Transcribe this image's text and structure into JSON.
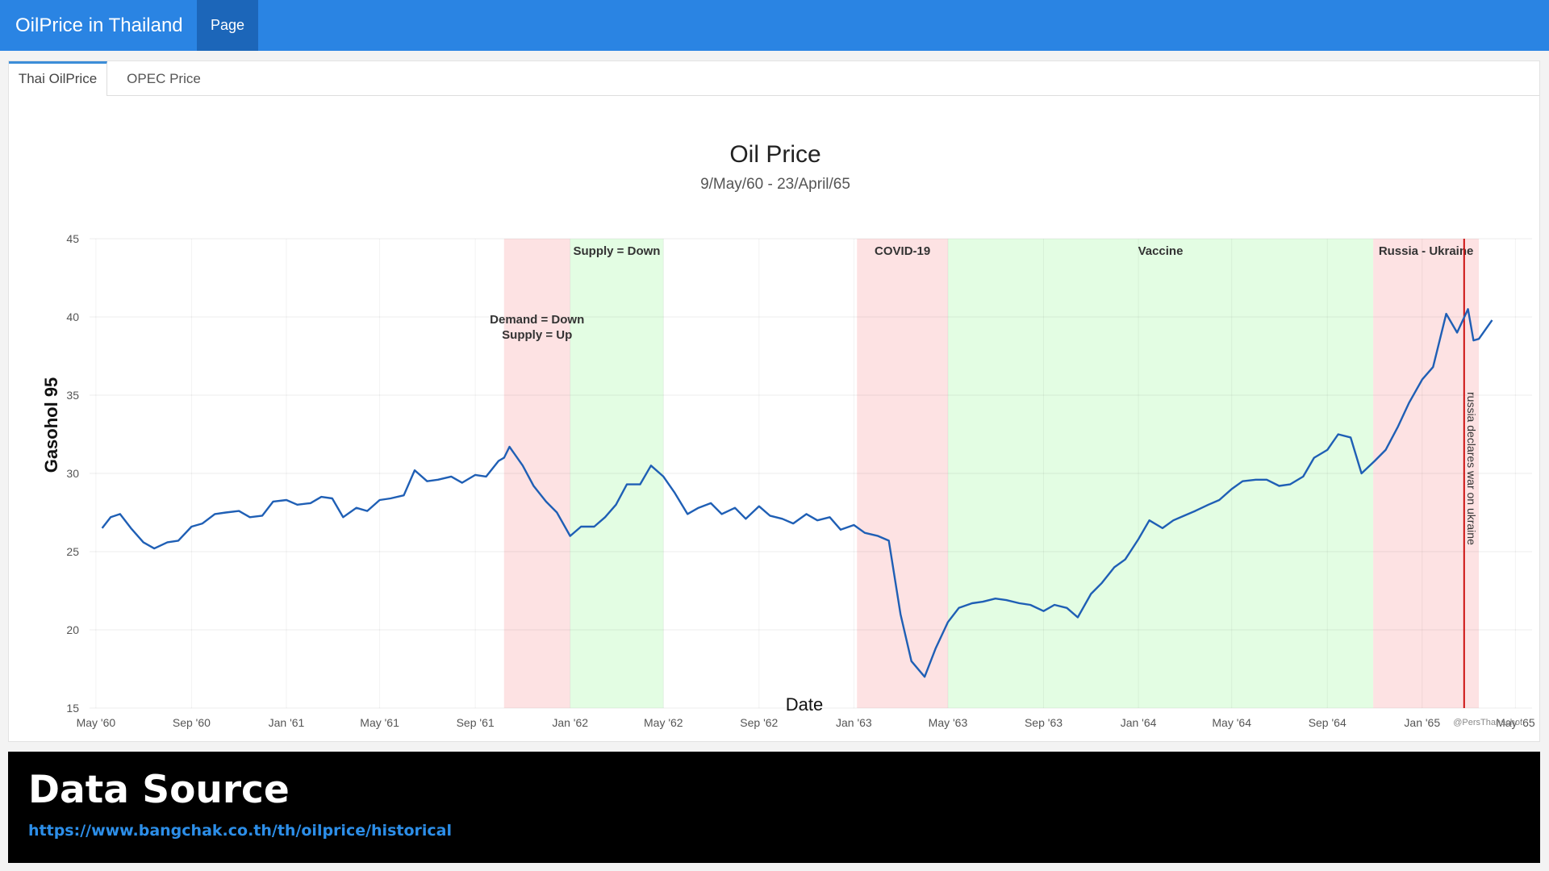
{
  "navbar": {
    "brand": "OilPrice in Thailand",
    "items": [
      {
        "label": "Page"
      }
    ]
  },
  "tabs": [
    {
      "label": "Thai OilPrice",
      "active": true
    },
    {
      "label": "OPEC Price",
      "active": false
    }
  ],
  "chart_data": {
    "type": "line",
    "title": "Oil Price",
    "subtitle": "9/May/60 - 23/April/65",
    "xlabel": "Date",
    "ylabel": "Gasohol 95",
    "ylim": [
      15,
      45
    ],
    "y_ticks": [
      15,
      20,
      25,
      30,
      35,
      40,
      45
    ],
    "x_ticks": [
      "May '60",
      "Sep '60",
      "Jan '61",
      "May '61",
      "Sep '61",
      "Jan '62",
      "May '62",
      "Sep '62",
      "Jan '63",
      "May '63",
      "Sep '63",
      "Jan '64",
      "May '64",
      "Sep '64",
      "Jan '65",
      "May '65"
    ],
    "grid": true,
    "line_color": "#1f5fb5",
    "x": [
      "2017-05-09",
      "2017-05-20",
      "2017-06-01",
      "2017-06-15",
      "2017-07-01",
      "2017-07-15",
      "2017-08-01",
      "2017-08-15",
      "2017-09-01",
      "2017-09-15",
      "2017-10-01",
      "2017-10-15",
      "2017-11-01",
      "2017-11-15",
      "2017-12-01",
      "2017-12-15",
      "2018-01-01",
      "2018-01-15",
      "2018-02-01",
      "2018-02-15",
      "2018-03-01",
      "2018-03-15",
      "2018-04-01",
      "2018-04-15",
      "2018-05-01",
      "2018-05-15",
      "2018-06-01",
      "2018-06-15",
      "2018-07-01",
      "2018-07-15",
      "2018-08-01",
      "2018-08-15",
      "2018-09-01",
      "2018-09-15",
      "2018-10-01",
      "2018-10-08",
      "2018-10-15",
      "2018-11-01",
      "2018-11-15",
      "2018-12-01",
      "2018-12-15",
      "2019-01-01",
      "2019-01-15",
      "2019-02-01",
      "2019-02-15",
      "2019-03-01",
      "2019-03-15",
      "2019-04-01",
      "2019-04-15",
      "2019-05-01",
      "2019-05-15",
      "2019-06-01",
      "2019-06-15",
      "2019-07-01",
      "2019-07-15",
      "2019-08-01",
      "2019-08-15",
      "2019-09-01",
      "2019-09-15",
      "2019-10-01",
      "2019-10-15",
      "2019-11-01",
      "2019-11-15",
      "2019-12-01",
      "2019-12-15",
      "2020-01-01",
      "2020-01-15",
      "2020-02-01",
      "2020-02-15",
      "2020-03-01",
      "2020-03-15",
      "2020-04-01",
      "2020-04-15",
      "2020-05-01",
      "2020-05-15",
      "2020-06-01",
      "2020-06-15",
      "2020-07-01",
      "2020-07-15",
      "2020-08-01",
      "2020-08-15",
      "2020-09-01",
      "2020-09-15",
      "2020-10-01",
      "2020-10-15",
      "2020-11-01",
      "2020-11-15",
      "2020-12-01",
      "2020-12-15",
      "2021-01-01",
      "2021-01-15",
      "2021-02-01",
      "2021-02-15",
      "2021-03-01",
      "2021-03-15",
      "2021-04-01",
      "2021-04-15",
      "2021-05-01",
      "2021-05-15",
      "2021-06-01",
      "2021-06-15",
      "2021-07-01",
      "2021-07-15",
      "2021-08-01",
      "2021-08-15",
      "2021-09-01",
      "2021-09-15",
      "2021-10-01",
      "2021-10-15",
      "2021-11-01",
      "2021-11-15",
      "2021-12-01",
      "2021-12-15",
      "2022-01-01",
      "2022-01-15",
      "2022-02-01",
      "2022-02-15",
      "2022-03-01",
      "2022-03-08",
      "2022-03-15",
      "2022-04-01",
      "2022-04-10",
      "2022-04-23"
    ],
    "y": [
      26.5,
      27.2,
      27.4,
      26.5,
      25.6,
      25.2,
      25.6,
      25.7,
      26.6,
      26.8,
      27.4,
      27.5,
      27.6,
      27.2,
      27.3,
      28.2,
      28.3,
      28.0,
      28.1,
      28.5,
      28.4,
      27.2,
      27.8,
      27.6,
      28.3,
      28.4,
      28.6,
      30.2,
      29.5,
      29.6,
      29.8,
      29.4,
      29.9,
      29.8,
      30.8,
      31.0,
      31.7,
      30.5,
      29.2,
      28.2,
      27.5,
      26.0,
      26.6,
      26.6,
      27.2,
      28.0,
      29.3,
      29.3,
      30.5,
      29.8,
      28.8,
      27.4,
      27.8,
      28.1,
      27.4,
      27.8,
      27.1,
      27.9,
      27.3,
      27.1,
      26.8,
      27.4,
      27.0,
      27.2,
      26.4,
      26.7,
      26.2,
      26.0,
      25.7,
      21.0,
      18.0,
      17.0,
      18.8,
      20.5,
      21.4,
      21.7,
      21.8,
      22.0,
      21.9,
      21.7,
      21.6,
      21.2,
      21.6,
      21.4,
      20.8,
      22.3,
      23.0,
      24.0,
      24.5,
      25.8,
      27.0,
      26.5,
      27.0,
      27.3,
      27.6,
      28.0,
      28.3,
      29.0,
      29.5,
      29.6,
      29.6,
      29.2,
      29.3,
      29.8,
      31.0,
      31.5,
      32.5,
      32.3,
      30.0,
      30.8,
      31.5,
      33.0,
      34.5,
      36.0,
      36.8,
      40.2,
      39.0,
      40.5,
      38.5,
      38.6,
      39.8
    ],
    "annotations": [
      {
        "label": "Demand = Down\nSupply = Up",
        "start": "2018-10-08",
        "end": "2019-01-01",
        "color": "#fde2e3"
      },
      {
        "label": "Supply = Down",
        "start": "2019-01-01",
        "end": "2019-05-01",
        "color": "#e3fde3"
      },
      {
        "label": "COVID-19",
        "start": "2020-01-05",
        "end": "2020-05-01",
        "color": "#fde2e3"
      },
      {
        "label": "Vaccine",
        "start": "2020-05-01",
        "end": "2021-10-30",
        "color": "#e3fde3"
      },
      {
        "label": "Russia - Ukraine",
        "start": "2021-10-30",
        "end": "2022-03-15",
        "color": "#fde2e3"
      }
    ],
    "event_line": {
      "date": "2022-02-24",
      "label": "russia declares war on ukraine",
      "color": "#cc1111"
    },
    "credit": "@PersThanachot"
  },
  "footer": {
    "title": "Data Source",
    "link": "https://www.bangchak.co.th/th/oilprice/historical"
  }
}
